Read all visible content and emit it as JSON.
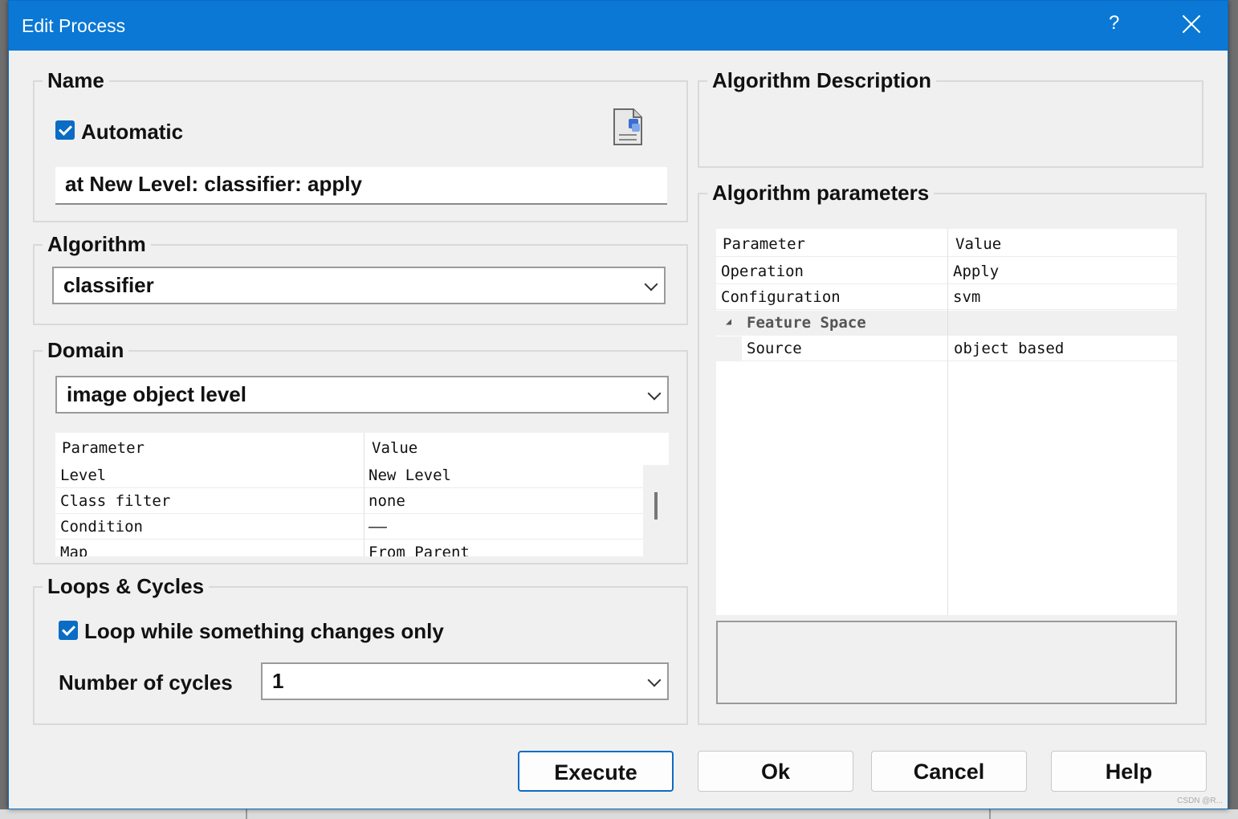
{
  "window": {
    "title": "Edit Process",
    "help_glyph": "?"
  },
  "name_group": {
    "legend": "Name",
    "automatic_label": "Automatic",
    "name_value": "at  New Level: classifier: apply"
  },
  "algorithm_group": {
    "legend": "Algorithm",
    "selected": "classifier"
  },
  "domain_group": {
    "legend": "Domain",
    "selected": "image object level",
    "grid": {
      "headers": [
        "Parameter",
        "Value"
      ],
      "rows": [
        {
          "param": "Level",
          "value": "New Level"
        },
        {
          "param": "Class filter",
          "value": "none"
        },
        {
          "param": "Condition",
          "value": "——"
        },
        {
          "param": "Map",
          "value": "From Parent"
        }
      ]
    }
  },
  "loops_group": {
    "legend": "Loops & Cycles",
    "loop_label": "Loop while something changes only",
    "cycles_label": "Number of cycles",
    "cycles_value": "1"
  },
  "algorithm_description": {
    "legend": "Algorithm Description"
  },
  "algorithm_parameters": {
    "legend": "Algorithm parameters",
    "headers": [
      "Parameter",
      "Value"
    ],
    "rows": [
      {
        "param": "Operation",
        "value": "Apply"
      },
      {
        "param": "Configuration",
        "value": "svm"
      },
      {
        "param": "Feature Space",
        "value": "",
        "expander": "◢"
      },
      {
        "param": "Source",
        "value": "object based"
      }
    ]
  },
  "buttons": {
    "execute": "Execute",
    "ok": "Ok",
    "cancel": "Cancel",
    "help": "Help"
  },
  "watermark": "CSDN @R..."
}
